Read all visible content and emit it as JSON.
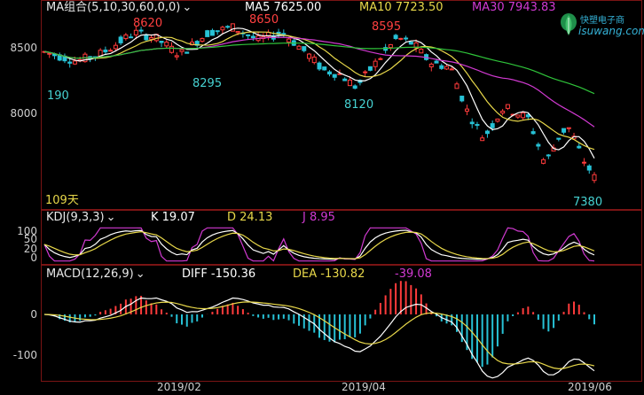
{
  "main_panel": {
    "indicator_menu": "MA组合(5,10,30,60,0,0)",
    "ma5": "MA5 7625.00",
    "ma10": "MA10 7723.50",
    "ma30": "MA30 7943.83",
    "y_ticks": [
      "8500",
      "8000"
    ],
    "annotations": {
      "high1": "8620",
      "high2": "8650",
      "high3": "8595",
      "low1": "190",
      "low2": "8295",
      "low3": "8120",
      "last": "7380"
    },
    "period_label": "109天"
  },
  "kdj_panel": {
    "menu": "KDJ(9,3,3)",
    "k": "K 19.07",
    "d": "D 24.13",
    "j": "J 8.95",
    "y_ticks": [
      "100",
      "50",
      "20",
      "0"
    ]
  },
  "macd_panel": {
    "menu": "MACD(12,26,9)",
    "diff": "DIFF -150.36",
    "dea": "DEA -130.82",
    "macd": "-39.08",
    "y_ticks": [
      "0",
      "-100"
    ]
  },
  "x_axis": [
    "2019/02",
    "2019/04",
    "2019/06"
  ],
  "logo": {
    "cn": "快塑电子商",
    "en": "isuwang.com"
  },
  "colors": {
    "up": "#ff3b3b",
    "down": "#27c2d6",
    "ma5": "#ffffff",
    "ma10": "#e8d84a",
    "ma30": "#d23ad2",
    "ma60": "#2fc43a",
    "label_cyan": "#46d2d2",
    "label_red": "#ff4040",
    "frame": "#7a1414"
  }
}
